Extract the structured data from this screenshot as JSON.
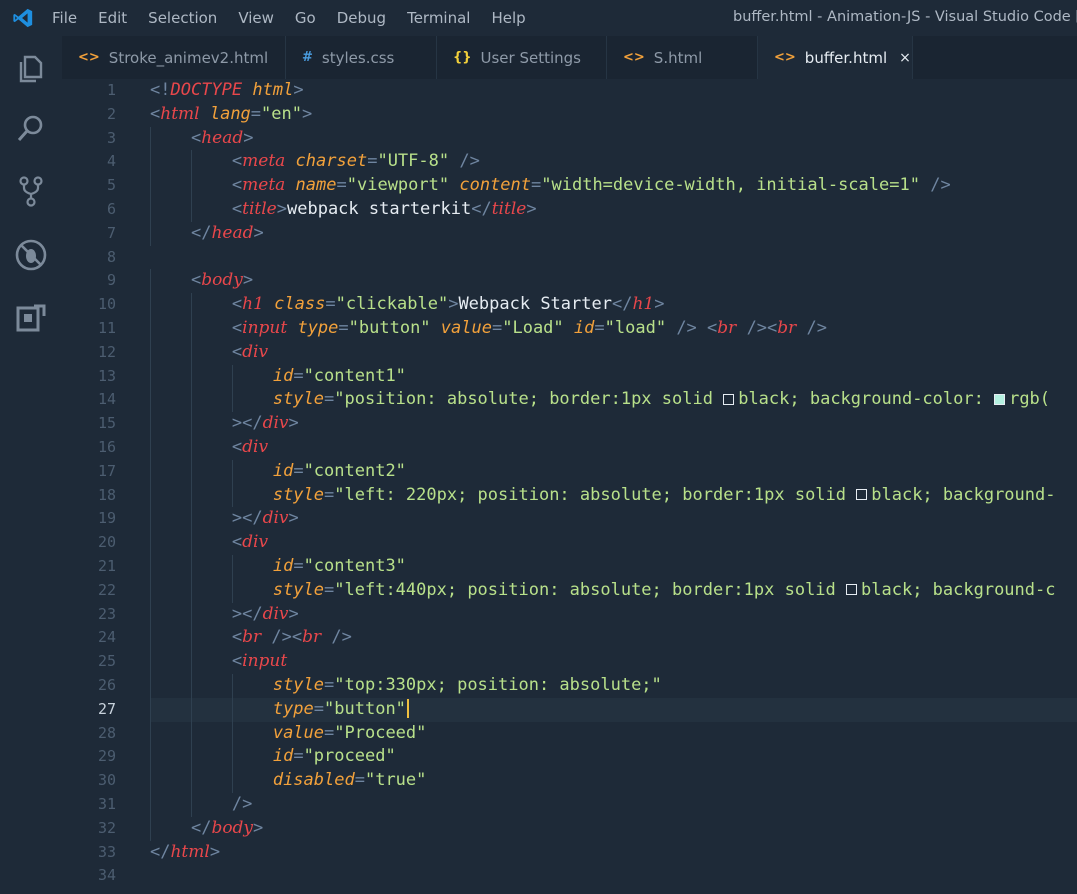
{
  "menu": [
    "File",
    "Edit",
    "Selection",
    "View",
    "Go",
    "Debug",
    "Terminal",
    "Help"
  ],
  "window_title": "buffer.html - Animation-JS - Visual Studio Code [",
  "tabs": [
    {
      "icon": "<>",
      "label": "Stroke_animev2.html"
    },
    {
      "icon": "#",
      "label": "styles.css"
    },
    {
      "icon": "{}",
      "label": "User Settings"
    },
    {
      "icon": "<>",
      "label": "S.html"
    },
    {
      "icon": "<>",
      "label": "buffer.html",
      "active": true,
      "close": "×"
    }
  ],
  "colors": {
    "accent_icon": "#1e8fe0",
    "tag": "#e8474b",
    "attr": "#f2a13b",
    "string": "#b8e08a",
    "swatch_rgb": "#b4f0e0"
  },
  "activity_icons": [
    "explorer-icon",
    "search-icon",
    "source-control-icon",
    "debug-icon",
    "extensions-icon"
  ],
  "editor": {
    "active_line": 27,
    "line_numbers": [
      "1",
      "2",
      "3",
      "4",
      "5",
      "6",
      "7",
      "8",
      "9",
      "10",
      "11",
      "12",
      "13",
      "14",
      "15",
      "16",
      "17",
      "18",
      "19",
      "20",
      "21",
      "22",
      "23",
      "24",
      "25",
      "26",
      "27",
      "28",
      "29",
      "30",
      "31",
      "32",
      "33",
      "34"
    ],
    "lines": [
      [
        [
          "pu",
          "<!"
        ],
        [
          "kw",
          "DOCTYPE"
        ],
        [
          "tx",
          " "
        ],
        [
          "at",
          "html"
        ],
        [
          "pu",
          ">"
        ]
      ],
      [
        [
          "pu",
          "<"
        ],
        [
          "tg",
          "html"
        ],
        [
          "tx",
          " "
        ],
        [
          "at",
          "lang"
        ],
        [
          "pu",
          "="
        ],
        [
          "st",
          "\"en\""
        ],
        [
          "pu",
          ">"
        ]
      ],
      [
        [
          "tx",
          "    "
        ],
        [
          "pu",
          "<"
        ],
        [
          "tg",
          "head"
        ],
        [
          "pu",
          ">"
        ]
      ],
      [
        [
          "tx",
          "        "
        ],
        [
          "pu",
          "<"
        ],
        [
          "tg",
          "meta"
        ],
        [
          "tx",
          " "
        ],
        [
          "at",
          "charset"
        ],
        [
          "pu",
          "="
        ],
        [
          "st",
          "\"UTF-8\""
        ],
        [
          "tx",
          " "
        ],
        [
          "pu",
          "/>"
        ]
      ],
      [
        [
          "tx",
          "        "
        ],
        [
          "pu",
          "<"
        ],
        [
          "tg",
          "meta"
        ],
        [
          "tx",
          " "
        ],
        [
          "at",
          "name"
        ],
        [
          "pu",
          "="
        ],
        [
          "st",
          "\"viewport\""
        ],
        [
          "tx",
          " "
        ],
        [
          "at",
          "content"
        ],
        [
          "pu",
          "="
        ],
        [
          "st",
          "\"width=device-width, initial-scale=1\""
        ],
        [
          "tx",
          " "
        ],
        [
          "pu",
          "/>"
        ]
      ],
      [
        [
          "tx",
          "        "
        ],
        [
          "pu",
          "<"
        ],
        [
          "tg",
          "title"
        ],
        [
          "pu",
          ">"
        ],
        [
          "tx",
          "webpack starterkit"
        ],
        [
          "pu",
          "</"
        ],
        [
          "tg",
          "title"
        ],
        [
          "pu",
          ">"
        ]
      ],
      [
        [
          "tx",
          "    "
        ],
        [
          "pu",
          "</"
        ],
        [
          "tg",
          "head"
        ],
        [
          "pu",
          ">"
        ]
      ],
      [],
      [
        [
          "tx",
          "    "
        ],
        [
          "pu",
          "<"
        ],
        [
          "tg",
          "body"
        ],
        [
          "pu",
          ">"
        ]
      ],
      [
        [
          "tx",
          "        "
        ],
        [
          "pu",
          "<"
        ],
        [
          "tg",
          "h1"
        ],
        [
          "tx",
          " "
        ],
        [
          "at",
          "class"
        ],
        [
          "pu",
          "="
        ],
        [
          "st",
          "\"clickable\""
        ],
        [
          "pu",
          ">"
        ],
        [
          "tx",
          "Webpack Starter"
        ],
        [
          "pu",
          "</"
        ],
        [
          "tg",
          "h1"
        ],
        [
          "pu",
          ">"
        ]
      ],
      [
        [
          "tx",
          "        "
        ],
        [
          "pu",
          "<"
        ],
        [
          "tg",
          "input"
        ],
        [
          "tx",
          " "
        ],
        [
          "at",
          "type"
        ],
        [
          "pu",
          "="
        ],
        [
          "st",
          "\"button\""
        ],
        [
          "tx",
          " "
        ],
        [
          "at",
          "value"
        ],
        [
          "pu",
          "="
        ],
        [
          "st",
          "\"Load\""
        ],
        [
          "tx",
          " "
        ],
        [
          "at",
          "id"
        ],
        [
          "pu",
          "="
        ],
        [
          "st",
          "\"load\""
        ],
        [
          "tx",
          " "
        ],
        [
          "pu",
          "/>"
        ],
        [
          "tx",
          " "
        ],
        [
          "pu",
          "<"
        ],
        [
          "tg",
          "br"
        ],
        [
          "tx",
          " "
        ],
        [
          "pu",
          "/><"
        ],
        [
          "tg",
          "br"
        ],
        [
          "tx",
          " "
        ],
        [
          "pu",
          "/>"
        ]
      ],
      [
        [
          "tx",
          "        "
        ],
        [
          "pu",
          "<"
        ],
        [
          "tg",
          "div"
        ]
      ],
      [
        [
          "tx",
          "            "
        ],
        [
          "at",
          "id"
        ],
        [
          "pu",
          "="
        ],
        [
          "st",
          "\"content1\""
        ]
      ],
      [
        [
          "tx",
          "            "
        ],
        [
          "at",
          "style"
        ],
        [
          "pu",
          "="
        ],
        [
          "st",
          "\"position: absolute; border:1px solid "
        ],
        [
          "sw",
          "#000000"
        ],
        [
          "st",
          "black; background-color: "
        ],
        [
          "sw",
          "#b4f0e0"
        ],
        [
          "st",
          "rgb("
        ]
      ],
      [
        [
          "tx",
          "        "
        ],
        [
          "pu",
          "></"
        ],
        [
          "tg",
          "div"
        ],
        [
          "pu",
          ">"
        ]
      ],
      [
        [
          "tx",
          "        "
        ],
        [
          "pu",
          "<"
        ],
        [
          "tg",
          "div"
        ]
      ],
      [
        [
          "tx",
          "            "
        ],
        [
          "at",
          "id"
        ],
        [
          "pu",
          "="
        ],
        [
          "st",
          "\"content2\""
        ]
      ],
      [
        [
          "tx",
          "            "
        ],
        [
          "at",
          "style"
        ],
        [
          "pu",
          "="
        ],
        [
          "st",
          "\"left: 220px; position: absolute; border:1px solid "
        ],
        [
          "sw",
          "#000000"
        ],
        [
          "st",
          "black; background-"
        ]
      ],
      [
        [
          "tx",
          "        "
        ],
        [
          "pu",
          "></"
        ],
        [
          "tg",
          "div"
        ],
        [
          "pu",
          ">"
        ]
      ],
      [
        [
          "tx",
          "        "
        ],
        [
          "pu",
          "<"
        ],
        [
          "tg",
          "div"
        ]
      ],
      [
        [
          "tx",
          "            "
        ],
        [
          "at",
          "id"
        ],
        [
          "pu",
          "="
        ],
        [
          "st",
          "\"content3\""
        ]
      ],
      [
        [
          "tx",
          "            "
        ],
        [
          "at",
          "style"
        ],
        [
          "pu",
          "="
        ],
        [
          "st",
          "\"left:440px; position: absolute; border:1px solid "
        ],
        [
          "sw",
          "#000000"
        ],
        [
          "st",
          "black; background-c"
        ]
      ],
      [
        [
          "tx",
          "        "
        ],
        [
          "pu",
          "></"
        ],
        [
          "tg",
          "div"
        ],
        [
          "pu",
          ">"
        ]
      ],
      [
        [
          "tx",
          "        "
        ],
        [
          "pu",
          "<"
        ],
        [
          "tg",
          "br"
        ],
        [
          "tx",
          " "
        ],
        [
          "pu",
          "/><"
        ],
        [
          "tg",
          "br"
        ],
        [
          "tx",
          " "
        ],
        [
          "pu",
          "/>"
        ]
      ],
      [
        [
          "tx",
          "        "
        ],
        [
          "pu",
          "<"
        ],
        [
          "tg",
          "input"
        ]
      ],
      [
        [
          "tx",
          "            "
        ],
        [
          "at",
          "style"
        ],
        [
          "pu",
          "="
        ],
        [
          "st",
          "\"top:330px; position: absolute;\""
        ]
      ],
      [
        [
          "tx",
          "            "
        ],
        [
          "at",
          "type"
        ],
        [
          "pu",
          "="
        ],
        [
          "st",
          "\"button\""
        ],
        [
          "cur",
          ""
        ]
      ],
      [
        [
          "tx",
          "            "
        ],
        [
          "at",
          "value"
        ],
        [
          "pu",
          "="
        ],
        [
          "st",
          "\"Proceed\""
        ]
      ],
      [
        [
          "tx",
          "            "
        ],
        [
          "at",
          "id"
        ],
        [
          "pu",
          "="
        ],
        [
          "st",
          "\"proceed\""
        ]
      ],
      [
        [
          "tx",
          "            "
        ],
        [
          "at",
          "disabled"
        ],
        [
          "pu",
          "="
        ],
        [
          "st",
          "\"true\""
        ]
      ],
      [
        [
          "tx",
          "        "
        ],
        [
          "pu",
          "/>"
        ]
      ],
      [
        [
          "tx",
          "    "
        ],
        [
          "pu",
          "</"
        ],
        [
          "tg",
          "body"
        ],
        [
          "pu",
          ">"
        ]
      ],
      [
        [
          "pu",
          "</"
        ],
        [
          "tg",
          "html"
        ],
        [
          "pu",
          ">"
        ]
      ],
      []
    ]
  }
}
